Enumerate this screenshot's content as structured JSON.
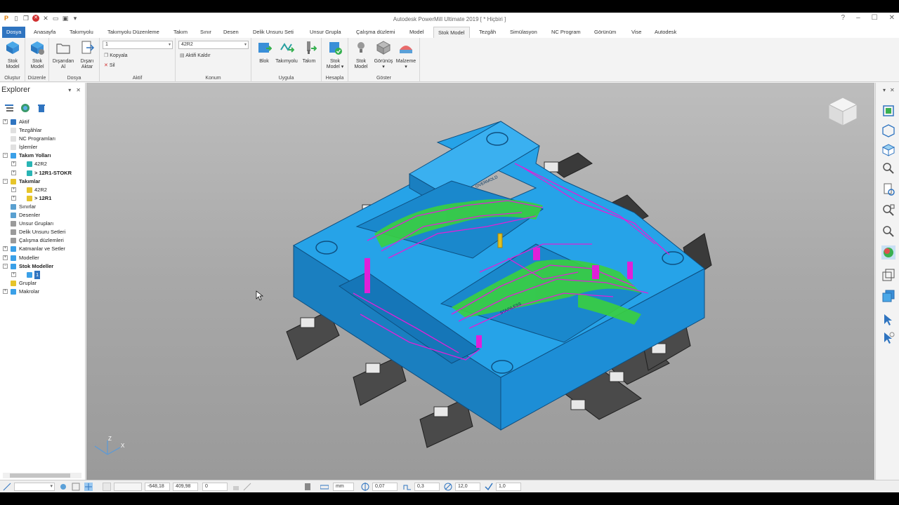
{
  "titlebar": {
    "title": "Autodesk PowerMill Ultimate 2019   [ * Hiçbiri ]",
    "help": "?",
    "minimize": "–",
    "maximize": "☐",
    "close": "✕"
  },
  "menu": {
    "tabs": [
      "Dosya",
      "Anasayfa",
      "Takımyolu",
      "Takımyolu Düzenleme",
      "Takım",
      "Sınır",
      "Desen",
      "Delik Unsuru Seti",
      "Unsur Grupla",
      "Çalışma düzlemi",
      "Model",
      "Stok Model",
      "Tezgâh",
      "Simülasyon",
      "NC Program",
      "Görünüm",
      "Vise",
      "Autodesk"
    ],
    "active": "Stok Model"
  },
  "ribbon": {
    "olustur": {
      "btn": "Stok\nModel",
      "group": "Oluştur"
    },
    "duzenle": {
      "btn": "Stok\nModel",
      "group": "Düzenle"
    },
    "dosya": {
      "btn1": "Dışarıdan\nAl",
      "btn2": "Dışarı\nAktar",
      "group": "Dosya"
    },
    "aktif": {
      "combo": "1",
      "copy": "Kopyala",
      "delete": "Sil",
      "group": "Aktif"
    },
    "konum": {
      "combo": "42R2",
      "deactivate": "Aktifi Kaldır",
      "group": "Konum"
    },
    "uygula": {
      "btn1": "Blok",
      "btn2": "Takımyolu",
      "btn3": "Takım",
      "group": "Uygula"
    },
    "hesapla": {
      "btn": "Stok\nModel ▾",
      "group": "Hesapla"
    },
    "goster": {
      "btn1": "Stok\nModel",
      "btn2": "Görünüş\n▾",
      "btn3": "Malzeme\n▾",
      "group": "Göster"
    }
  },
  "explorer": {
    "title": "Explorer",
    "pin": "▾",
    "close": "✕",
    "tree": [
      {
        "label": "Aktif",
        "bold": false,
        "indent": 0,
        "exp": "+",
        "icon": "#2f74c0"
      },
      {
        "label": "Tezgâhlar",
        "bold": false,
        "indent": 0,
        "exp": "",
        "icon": "#e0e0e0"
      },
      {
        "label": "NC Programları",
        "bold": false,
        "indent": 0,
        "exp": "",
        "icon": "#e0e0e0"
      },
      {
        "label": "İşlemler",
        "bold": false,
        "indent": 0,
        "exp": "",
        "icon": "#e0e0e0"
      },
      {
        "label": "Takım Yolları",
        "bold": true,
        "indent": 0,
        "exp": "−",
        "icon": "#3aa0e8"
      },
      {
        "label": "42R2",
        "bold": false,
        "indent": 2,
        "exp": "+",
        "icon": "#29b4b4"
      },
      {
        "label": "> 12R1-STOKR",
        "bold": true,
        "indent": 2,
        "exp": "+",
        "icon": "#29b4b4"
      },
      {
        "label": "Takımlar",
        "bold": true,
        "indent": 0,
        "exp": "−",
        "icon": "#e6c42a"
      },
      {
        "label": "42R2",
        "bold": false,
        "indent": 2,
        "exp": "+",
        "icon": "#e6c42a"
      },
      {
        "label": "> 12R1",
        "bold": true,
        "indent": 2,
        "exp": "+",
        "icon": "#e6c42a"
      },
      {
        "label": "Sınırlar",
        "bold": false,
        "indent": 0,
        "exp": "",
        "icon": "#5aa0d0"
      },
      {
        "label": "Desenler",
        "bold": false,
        "indent": 0,
        "exp": "",
        "icon": "#5aa0d0"
      },
      {
        "label": "Unsur Grupları",
        "bold": false,
        "indent": 0,
        "exp": "",
        "icon": "#9a9a9a"
      },
      {
        "label": "Delik Unsuru Setleri",
        "bold": false,
        "indent": 0,
        "exp": "",
        "icon": "#9a9a9a"
      },
      {
        "label": "Çalışma düzlemleri",
        "bold": false,
        "indent": 0,
        "exp": "",
        "icon": "#9a9a9a"
      },
      {
        "label": "Katmanlar ve Setler",
        "bold": false,
        "indent": 0,
        "exp": "+",
        "icon": "#3aa0e8"
      },
      {
        "label": "Modeller",
        "bold": false,
        "indent": 0,
        "exp": "+",
        "icon": "#3aa0e8"
      },
      {
        "label": "Stok Modeller",
        "bold": true,
        "indent": 0,
        "exp": "−",
        "icon": "#3aa0e8"
      },
      {
        "label": "1",
        "bold": false,
        "indent": 2,
        "exp": "+",
        "icon": "#3aa0e8",
        "selected": true
      },
      {
        "label": "Gruplar",
        "bold": false,
        "indent": 0,
        "exp": "",
        "icon": "#e6c42a"
      },
      {
        "label": "Makrolar",
        "bold": false,
        "indent": 0,
        "exp": "+",
        "icon": "#3aa0e8"
      }
    ]
  },
  "viewport": {
    "part_color": "#1f9de0",
    "toolpath_color": "#e020d8",
    "stock_color": "#36d23a",
    "engrave1": "OVERMOLD",
    "engrave2": "STAINLESS",
    "axis_z": "Z",
    "axis_x": "X"
  },
  "statusbar": {
    "combo": "",
    "coord_x": "-648,18",
    "coord_y": "409,98",
    "coord_z": "0",
    "units": "mm",
    "tolerance": "0,07",
    "stepover": "0,3",
    "diameter": "12,0",
    "factor": "1,0"
  }
}
